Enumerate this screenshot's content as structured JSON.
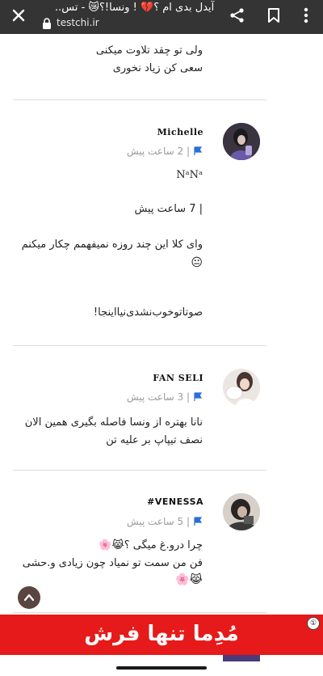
{
  "browser": {
    "title": "آیدل بدی ام ؟💔 ! ونسا!؟😿 - تس..",
    "url": "testchi.ir",
    "icons": [
      "close-icon",
      "lock-icon",
      "share-icon",
      "bookmark-icon",
      "more-vert-icon"
    ]
  },
  "comments": {
    "prev": {
      "lines": [
        "ولی تو چقد تلاوت میکنی",
        "سعی کن زیاد نخوری"
      ]
    },
    "michelle": {
      "author": "Michelle",
      "time": "| 2 ساعت پیش",
      "lines": [
        "NᵃNᵃ",
        "| 7 ساعت پیش",
        "وای کلا این چند روزه نمیفهمم چکار میکنم",
        "😐",
        "صوتاتوخوب‌نشدی‌نیااینجا!"
      ]
    },
    "fanseli": {
      "author": "FAN SELI",
      "time": "| 3 ساعت پیش",
      "lines": [
        "نانا بهتره از ونسا فاصله بگیری همین الان",
        "نصف تیپاپ بر علیه تن"
      ]
    },
    "venessa": {
      "author": "#VENESSA",
      "time": "| 5 ساعت پیش",
      "lines": [
        "چرا درو.غ میگی ؟😹🌸",
        "فن من سمت تو نمیاد چون زیادی و.حشی",
        "😹🌸"
      ]
    }
  },
  "ad": {
    "text": "مُدِما تنها فرش",
    "close_label": "①",
    "color": "#e61a1a"
  },
  "colors": {
    "topbar": "#343434",
    "flag": "#2b6fd8",
    "meta": "#9a9a9a"
  }
}
